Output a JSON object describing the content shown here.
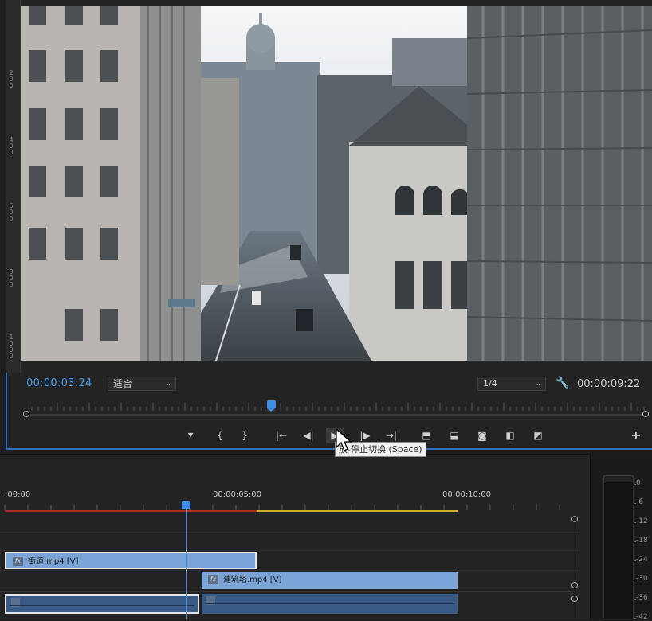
{
  "monitor": {
    "timecode": "00:00:03:24",
    "fit_select": "适合",
    "resolution_select": "1/4",
    "duration": "00:00:09:22",
    "ruler_labels": [
      "2\n0\n0",
      "4\n0\n0",
      "6\n0\n0",
      "8\n0\n0",
      "1\n0\n0\n0"
    ],
    "playhead_fraction": 0.4
  },
  "transport": {
    "buttons": [
      {
        "name": "add-marker-button",
        "icon": "marker-icon",
        "glyph": "⯆"
      },
      {
        "name": "mark-in-button",
        "icon": "mark-in-icon",
        "glyph": "{"
      },
      {
        "name": "mark-out-button",
        "icon": "mark-out-icon",
        "glyph": "}"
      },
      {
        "name": "go-to-in-button",
        "icon": "go-to-in-icon",
        "glyph": "|←"
      },
      {
        "name": "step-back-button",
        "icon": "step-back-icon",
        "glyph": "◀|"
      },
      {
        "name": "play-stop-button",
        "icon": "play-icon",
        "glyph": "▶"
      },
      {
        "name": "step-forward-button",
        "icon": "step-forward-icon",
        "glyph": "|▶"
      },
      {
        "name": "go-to-out-button",
        "icon": "go-to-out-icon",
        "glyph": "→|"
      },
      {
        "name": "lift-button",
        "icon": "lift-icon",
        "glyph": "⬒"
      },
      {
        "name": "extract-button",
        "icon": "extract-icon",
        "glyph": "⬓"
      },
      {
        "name": "export-frame-button",
        "icon": "camera-icon",
        "glyph": "◙"
      },
      {
        "name": "compare-view-button",
        "icon": "compare-icon",
        "glyph": "◧"
      },
      {
        "name": "multicam-button",
        "icon": "multicam-icon",
        "glyph": "◩"
      },
      {
        "name": "button-editor-button",
        "icon": "plus-icon",
        "glyph": "+"
      }
    ],
    "tooltip": "放-停止切换 (Space)"
  },
  "timeline": {
    "ruler_times": [
      ":00:00",
      "00:00:05:00",
      "00:00:10:00"
    ],
    "video_clips": [
      {
        "label": "街道.mp4 [V]",
        "fx": "fx"
      },
      {
        "label": "建筑塔.mp4 [V]",
        "fx": "fx"
      }
    ]
  },
  "meter": {
    "labels": [
      "0",
      "-6",
      "-12",
      "-18",
      "-24",
      "-30",
      "-36",
      "-42"
    ]
  },
  "colors": {
    "accent": "#3f9bf0",
    "clip_video": "#7aa4d6",
    "clip_audio": "#3a5a86",
    "work_area_rendered": "#b52a2a",
    "work_area_unrendered": "#c9b62c"
  }
}
